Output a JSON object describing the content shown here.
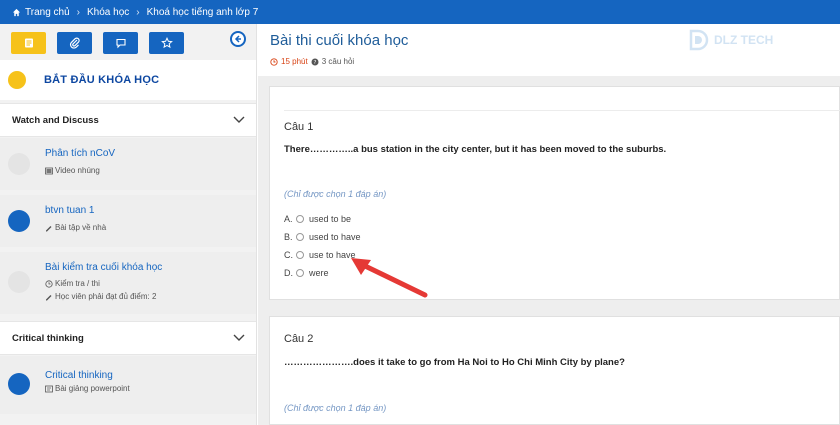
{
  "breadcrumb": {
    "items": [
      "Trang chủ",
      "Khóa học",
      "Khoá học tiếng anh lớp 7"
    ]
  },
  "sidebar": {
    "tabs": [
      {
        "icon": "note-icon",
        "active": true
      },
      {
        "icon": "attachment-icon",
        "active": false
      },
      {
        "icon": "comment-icon",
        "active": false
      },
      {
        "icon": "star-icon",
        "active": false
      }
    ],
    "start_label": "BẮT ĐẦU KHÓA HỌC",
    "sections": [
      {
        "title": "Watch and Discuss",
        "items": [
          {
            "title": "Phân tích nCoV",
            "meta": [
              "Video nhúng"
            ],
            "status": "incomplete"
          },
          {
            "title": "btvn tuan 1",
            "meta": [
              "Bài tập về nhà"
            ],
            "status": "complete"
          },
          {
            "title": "Bài kiểm tra cuối khóa học",
            "meta": [
              "Kiểm tra / thi",
              "Học viên phải đạt đủ điểm: 2"
            ],
            "status": "incomplete"
          }
        ]
      },
      {
        "title": "Critical thinking",
        "items": [
          {
            "title": "Critical thinking",
            "meta": [
              "Bài giảng powerpoint"
            ],
            "status": "complete"
          }
        ]
      }
    ]
  },
  "main": {
    "title": "Bài thi cuối khóa học",
    "duration": "15 phút",
    "questions_count": "3 câu hỏi",
    "logo_text": "DLZ TECH",
    "questions": [
      {
        "label": "Câu 1",
        "text": "There…………..a bus station in the city center, but it has been moved to the suburbs.",
        "hint": "(Chỉ được chọn 1 đáp án)",
        "options": [
          {
            "letter": "A.",
            "text": "used to be"
          },
          {
            "letter": "B.",
            "text": "used to have"
          },
          {
            "letter": "C.",
            "text": "use to have"
          },
          {
            "letter": "D.",
            "text": "were"
          }
        ]
      },
      {
        "label": "Câu 2",
        "text": "………………….does it take to go from Ha Noi to Ho Chi Minh City by plane?",
        "hint": "(Chỉ được chọn 1 đáp án)",
        "options": []
      }
    ]
  },
  "colors": {
    "primary": "#1565c0",
    "accent": "#f6c21a",
    "arrow": "#e53935",
    "time": "#d84315"
  }
}
